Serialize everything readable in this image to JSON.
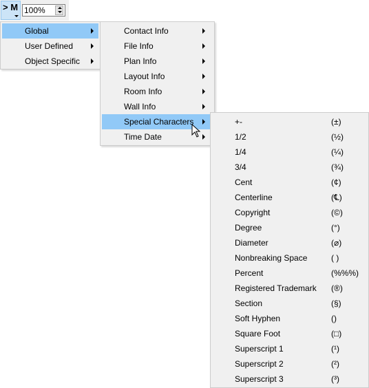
{
  "toolbar": {
    "macro_button_label": "> M",
    "zoom_value": "100%"
  },
  "menu1": {
    "items": [
      {
        "label": "Global",
        "highlighted": true
      },
      {
        "label": "User Defined"
      },
      {
        "label": "Object Specific"
      }
    ]
  },
  "menu2": {
    "items": [
      {
        "label": "Contact Info"
      },
      {
        "label": "File Info"
      },
      {
        "label": "Plan Info"
      },
      {
        "label": "Layout Info"
      },
      {
        "label": "Room Info"
      },
      {
        "label": "Wall Info"
      },
      {
        "label": "Special Characters",
        "highlighted": true
      },
      {
        "label": "Time  Date"
      }
    ]
  },
  "menu3": {
    "items": [
      {
        "label": "+-",
        "symbol": "(±)"
      },
      {
        "label": "1/2",
        "symbol": "(½)"
      },
      {
        "label": "1/4",
        "symbol": "(¼)"
      },
      {
        "label": "3/4",
        "symbol": "(¾)"
      },
      {
        "label": "Cent",
        "symbol": "(¢)"
      },
      {
        "label": "Centerline",
        "symbol": "(℄)"
      },
      {
        "label": "Copyright",
        "symbol": "(©)"
      },
      {
        "label": "Degree",
        "symbol": "(°)"
      },
      {
        "label": "Diameter",
        "symbol": "(⌀)"
      },
      {
        "label": "Nonbreaking Space",
        "symbol": "( )"
      },
      {
        "label": "Percent",
        "symbol": "(%%%)"
      },
      {
        "label": "Registered Trademark",
        "symbol": "(®)"
      },
      {
        "label": "Section",
        "symbol": "(§)"
      },
      {
        "label": "Soft Hyphen",
        "symbol": "()"
      },
      {
        "label": "Square Foot",
        "symbol": "(□)"
      },
      {
        "label": "Superscript 1",
        "symbol": "(¹)"
      },
      {
        "label": "Superscript 2",
        "symbol": "(²)"
      },
      {
        "label": "Superscript 3",
        "symbol": "(³)"
      }
    ]
  }
}
